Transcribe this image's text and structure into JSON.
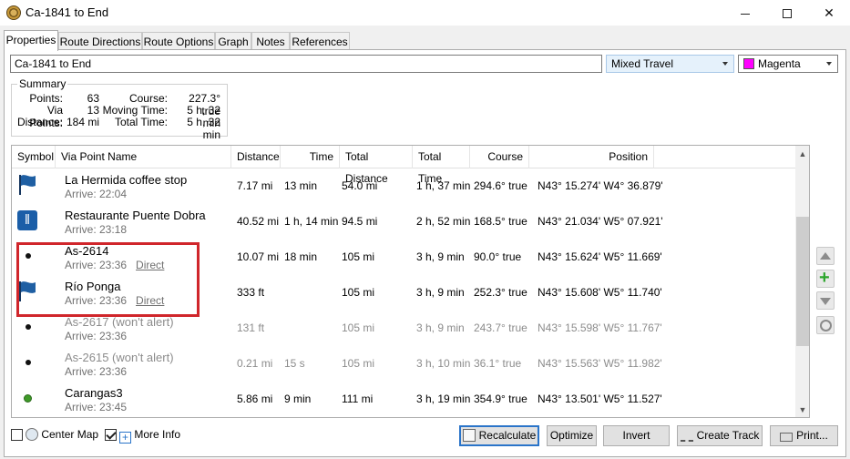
{
  "window": {
    "title": "Ca-1841 to End"
  },
  "tabs": [
    "Properties",
    "Route Directions",
    "Route Options",
    "Graph",
    "Notes",
    "References"
  ],
  "route": {
    "name_value": "Ca-1841 to End",
    "travel_mode": "Mixed Travel",
    "color_label": "Magenta",
    "color_hex": "#ff00ff"
  },
  "summary": {
    "title": "Summary",
    "points_label": "Points:",
    "points_value": "63",
    "via_points_label": "Via Points:",
    "via_points_value": "13",
    "distance_label": "Distance:",
    "distance_value": "184 mi",
    "course_label": "Course:",
    "course_value": "227.3° true",
    "moving_time_label": "Moving Time:",
    "moving_time_value": "5 h, 32 min",
    "total_time_label": "Total Time:",
    "total_time_value": "5 h, 32 min"
  },
  "table": {
    "headers": [
      "Symbol",
      "Via Point Name",
      "Distance",
      "Time",
      "Total Distance",
      "Total Time",
      "Course",
      "Position"
    ],
    "rows": [
      {
        "symbol": "blue-flag",
        "name": "La Hermida coffee stop",
        "arrive": "Arrive: 22:04",
        "direct": "",
        "distance": "7.17 mi",
        "time": "13 min",
        "total_distance": "54.0 mi",
        "total_time": "1 h, 37 min",
        "course": "294.6° true",
        "position": "N43° 15.274' W4° 36.879'",
        "dim": false
      },
      {
        "symbol": "restaurant",
        "name": "Restaurante Puente Dobra",
        "arrive": "Arrive: 23:18",
        "direct": "",
        "distance": "40.52 mi",
        "time": "1 h, 14 min",
        "total_distance": "94.5 mi",
        "total_time": "2 h, 52 min",
        "course": "168.5° true",
        "position": "N43° 21.034' W5° 07.921'",
        "dim": false
      },
      {
        "symbol": "dot",
        "name": "As-2614",
        "arrive": "Arrive: 23:36",
        "direct": "Direct",
        "distance": "10.07 mi",
        "time": "18 min",
        "total_distance": "105 mi",
        "total_time": "3 h, 9 min",
        "course": "90.0° true",
        "position": "N43° 15.624' W5° 11.669'",
        "dim": false
      },
      {
        "symbol": "blue-flag",
        "name": "Río Ponga",
        "arrive": "Arrive: 23:36",
        "direct": "Direct",
        "distance": "333 ft",
        "time": "",
        "total_distance": "105 mi",
        "total_time": "3 h, 9 min",
        "course": "252.3° true",
        "position": "N43° 15.608' W5° 11.740'",
        "dim": false
      },
      {
        "symbol": "dot",
        "name": "As-2617 (won't alert)",
        "arrive": "Arrive: 23:36",
        "direct": "",
        "distance": "131 ft",
        "time": "",
        "total_distance": "105 mi",
        "total_time": "3 h, 9 min",
        "course": "243.7° true",
        "position": "N43° 15.598' W5° 11.767'",
        "dim": true
      },
      {
        "symbol": "dot",
        "name": "As-2615 (won't alert)",
        "arrive": "Arrive: 23:36",
        "direct": "",
        "distance": "0.21 mi",
        "time": "15 s",
        "total_distance": "105 mi",
        "total_time": "3 h, 10 min",
        "course": "36.1° true",
        "position": "N43° 15.563' W5° 11.982'",
        "dim": true
      },
      {
        "symbol": "green-dot",
        "name": "Carangas3",
        "arrive": "Arrive: 23:45",
        "direct": "",
        "distance": "5.86 mi",
        "time": "9 min",
        "total_distance": "111 mi",
        "total_time": "3 h, 19 min",
        "course": "354.9° true",
        "position": "N43° 13.501' W5° 11.527'",
        "dim": false
      }
    ]
  },
  "bottom": {
    "center_map_label": "Center Map",
    "more_info_label": "More Info",
    "recalculate_label": "Recalculate",
    "optimize_label": "Optimize",
    "invert_label": "Invert",
    "create_track_label": "Create Track",
    "print_label": "Print..."
  }
}
